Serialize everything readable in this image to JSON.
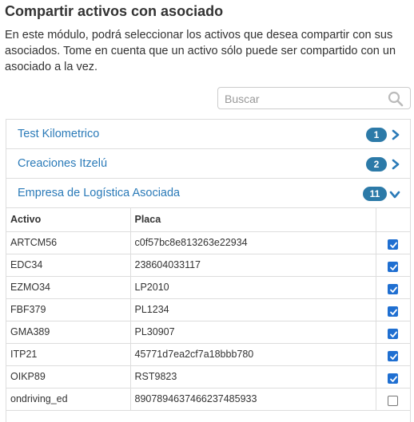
{
  "page": {
    "title": "Compartir activos con asociado",
    "description": "En este módulo, podrá seleccionar los activos que desea compartir con sus asociados. Tome en cuenta que un activo sólo puede ser compartido con un asociado a la vez."
  },
  "search": {
    "placeholder": "Buscar",
    "value": ""
  },
  "panels": [
    {
      "name": "Test Kilometrico",
      "count": "1",
      "expanded": false
    },
    {
      "name": "Creaciones Itzelú",
      "count": "2",
      "expanded": false
    },
    {
      "name": "Empresa de Logística Asociada",
      "count": "11",
      "expanded": true
    }
  ],
  "table": {
    "headers": [
      "Activo",
      "Placa",
      ""
    ],
    "rows": [
      {
        "activo": "ARTCM56",
        "placa": "c0f57bc8e813263e22934",
        "checked": true
      },
      {
        "activo": "EDC34",
        "placa": "238604033117",
        "checked": true
      },
      {
        "activo": "EZMO34",
        "placa": "LP2010",
        "checked": true
      },
      {
        "activo": "FBF379",
        "placa": "PL1234",
        "checked": true
      },
      {
        "activo": "GMA389",
        "placa": "PL30907",
        "checked": true
      },
      {
        "activo": "ITP21",
        "placa": "45771d7ea2cf7a18bbb780",
        "checked": true
      },
      {
        "activo": "OIKP89",
        "placa": "RST9823",
        "checked": true
      },
      {
        "activo": "ondriving_ed",
        "placa": "8907894637466237485933",
        "checked": false
      }
    ]
  },
  "colors": {
    "link": "#2a7ab8",
    "badge": "#2c7aa8",
    "checkbox": "#1f6fd1",
    "border": "#dddddd"
  },
  "icons": {
    "search": "search-icon",
    "collapsed": "chevron-right-icon",
    "expanded": "chevron-down-icon",
    "checked": "check-icon"
  }
}
